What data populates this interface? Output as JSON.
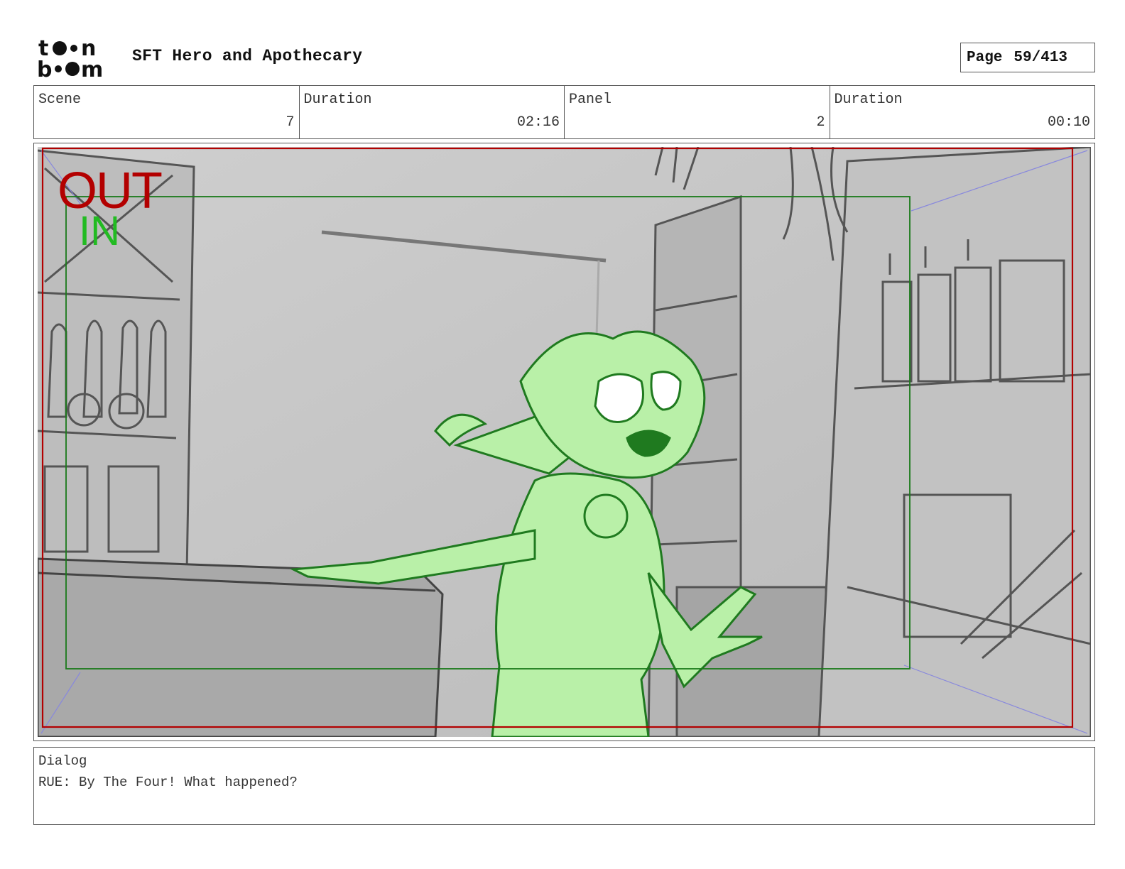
{
  "header": {
    "logo_text": "toon boom",
    "project_title": "SFT Hero and Apothecary",
    "page_label": "Page",
    "page_number": "59/413"
  },
  "info": {
    "scene_label": "Scene",
    "scene_value": "7",
    "scene_duration_label": "Duration",
    "scene_duration_value": "02:16",
    "panel_label": "Panel",
    "panel_value": "2",
    "panel_duration_label": "Duration",
    "panel_duration_value": "00:10"
  },
  "panel": {
    "out_label": "OUT",
    "in_label": "IN",
    "out_frame_color": "#b30000",
    "in_frame_color": "#1a7a1a",
    "character_color": "#b9f0a8"
  },
  "dialog": {
    "label": "Dialog",
    "text": "RUE: By The Four! What happened?"
  }
}
